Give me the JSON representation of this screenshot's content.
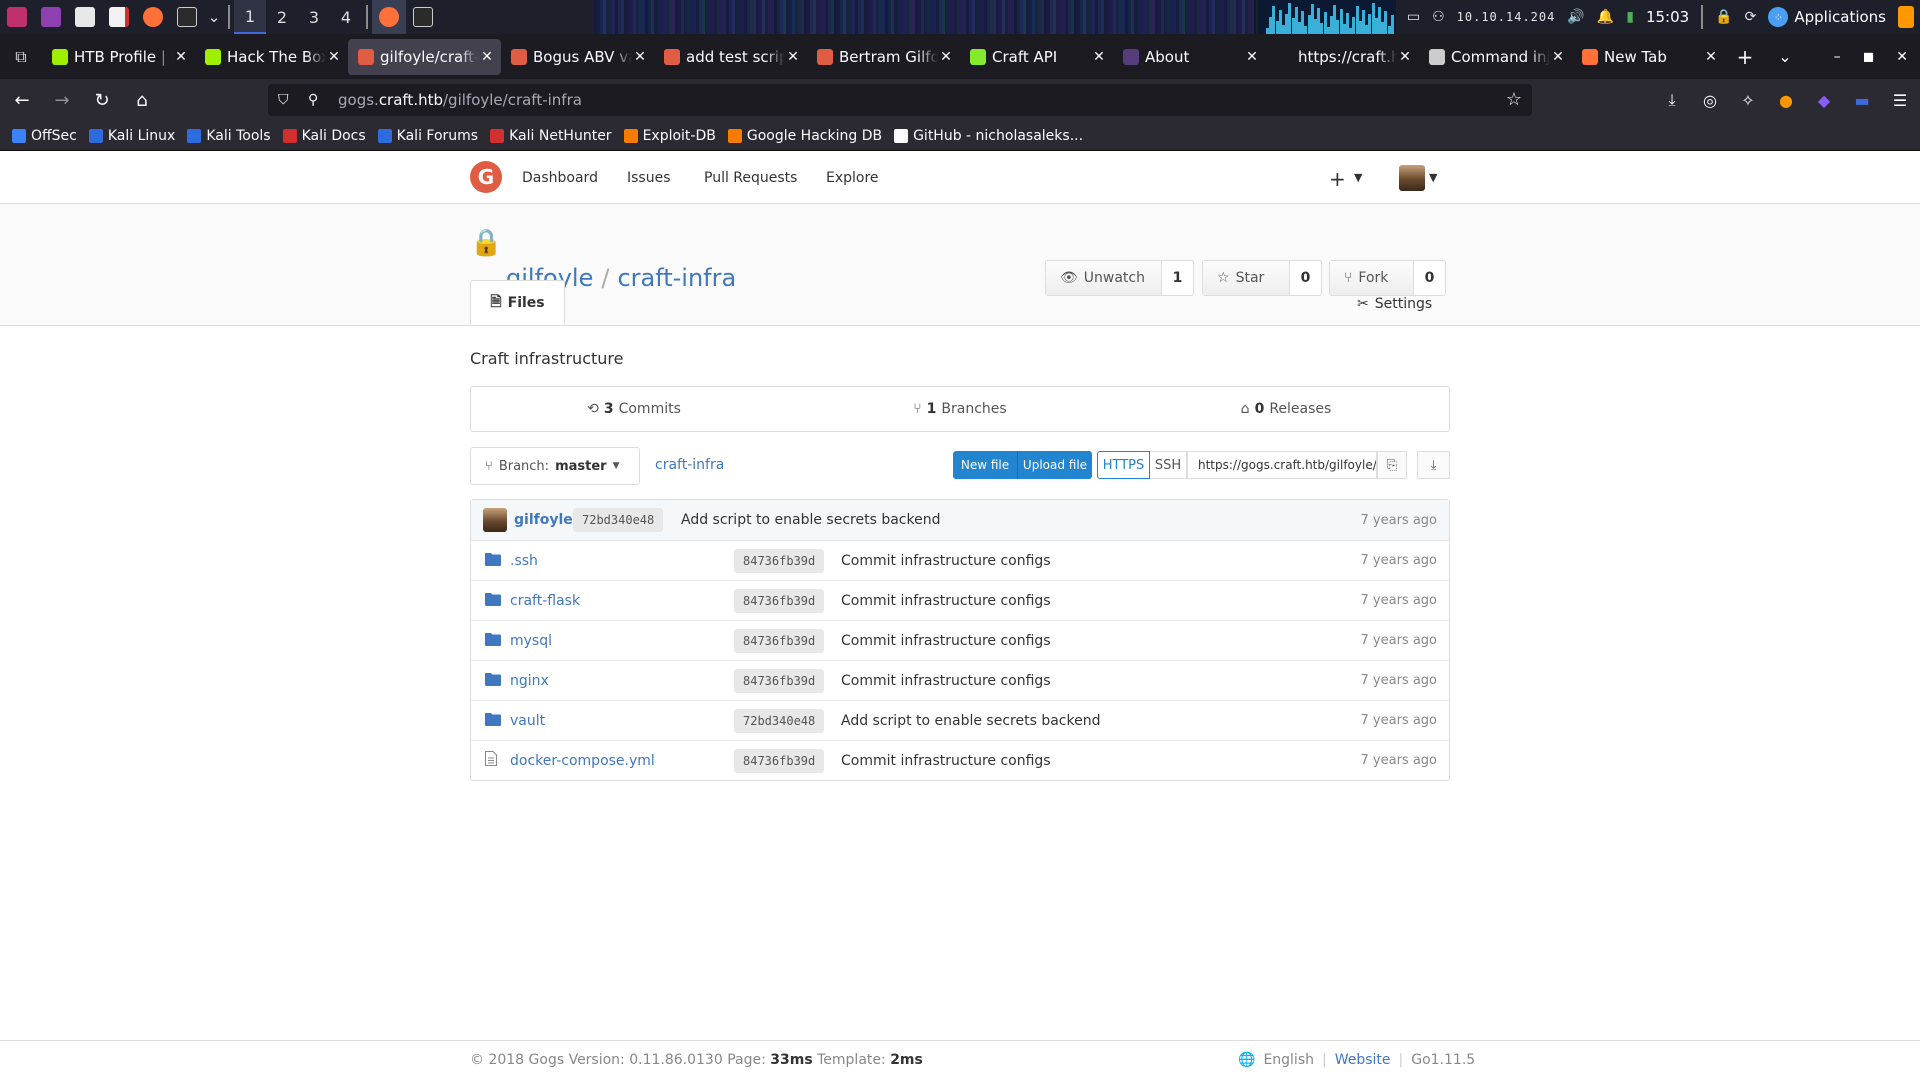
{
  "panel": {
    "workspaces": [
      "1",
      "2",
      "3",
      "4"
    ],
    "ip": "10.10.14.204",
    "clock": "15:03",
    "applications_label": "Applications"
  },
  "tabs": [
    {
      "label": "HTB Profile | H",
      "fav_color": "#9fef00"
    },
    {
      "label": "Hack The Box",
      "fav_color": "#9fef00"
    },
    {
      "label": "gilfoyle/craft-i",
      "fav_color": "#e05d44"
    },
    {
      "label": "Bogus ABV val",
      "fav_color": "#e05d44"
    },
    {
      "label": "add test script",
      "fav_color": "#e05d44"
    },
    {
      "label": "Bertram Gilfoy",
      "fav_color": "#e05d44"
    },
    {
      "label": "Craft API",
      "fav_color": "#85ea2d"
    },
    {
      "label": "About",
      "fav_color": "#563d7c"
    },
    {
      "label": "https://craft.htb/",
      "fav_color": ""
    },
    {
      "label": "Command inje",
      "fav_color": "#cccccc"
    },
    {
      "label": "New Tab",
      "fav_color": "#ff7139"
    }
  ],
  "url": {
    "prefix": "gogs.",
    "host": "craft.htb",
    "path": "/gilfoyle/craft-infra"
  },
  "bookmarks": [
    {
      "label": "OffSec",
      "color": "#3b82f6"
    },
    {
      "label": "Kali Linux",
      "color": "#2d6cdf"
    },
    {
      "label": "Kali Tools",
      "color": "#2d6cdf"
    },
    {
      "label": "Kali Docs",
      "color": "#d32f2f"
    },
    {
      "label": "Kali Forums",
      "color": "#2d6cdf"
    },
    {
      "label": "Kali NetHunter",
      "color": "#d32f2f"
    },
    {
      "label": "Exploit-DB",
      "color": "#f57c00"
    },
    {
      "label": "Google Hacking DB",
      "color": "#f57c00"
    },
    {
      "label": "GitHub - nicholasaleks...",
      "color": "#fbfbfe"
    }
  ],
  "gogs_nav": {
    "dashboard": "Dashboard",
    "issues": "Issues",
    "pull_requests": "Pull Requests",
    "explore": "Explore",
    "plus": "+"
  },
  "repo": {
    "owner": "gilfoyle",
    "slash": "/",
    "name": "craft-infra",
    "unwatch_label": "Unwatch",
    "watch_count": "1",
    "star_label": "Star",
    "star_count": "0",
    "fork_label": "Fork",
    "fork_count": "0",
    "files_tab": "Files",
    "settings_label": "Settings",
    "description": "Craft infrastructure",
    "commits_count": "3",
    "commits_label": "Commits",
    "branches_count": "1",
    "branches_label": "Branches",
    "releases_count": "0",
    "releases_label": "Releases",
    "branch_prefix": "Branch:",
    "branch_name": "master",
    "breadcrumb": "craft-infra",
    "new_file": "New file",
    "upload_file": "Upload file",
    "https_label": "HTTPS",
    "ssh_label": "SSH",
    "clone_url": "https://gogs.craft.htb/gilfoyle/craft-infra.git"
  },
  "latest_commit": {
    "user": "gilfoyle",
    "sha": "72bd340e48",
    "message": "Add script to enable secrets backend",
    "age": "7 years ago"
  },
  "files": [
    {
      "name": ".ssh",
      "type": "dir",
      "sha": "84736fb39d",
      "message": "Commit infrastructure configs",
      "age": "7 years ago"
    },
    {
      "name": "craft-flask",
      "type": "dir",
      "sha": "84736fb39d",
      "message": "Commit infrastructure configs",
      "age": "7 years ago"
    },
    {
      "name": "mysql",
      "type": "dir",
      "sha": "84736fb39d",
      "message": "Commit infrastructure configs",
      "age": "7 years ago"
    },
    {
      "name": "nginx",
      "type": "dir",
      "sha": "84736fb39d",
      "message": "Commit infrastructure configs",
      "age": "7 years ago"
    },
    {
      "name": "vault",
      "type": "dir",
      "sha": "72bd340e48",
      "message": "Add script to enable secrets backend",
      "age": "7 years ago"
    },
    {
      "name": "docker-compose.yml",
      "type": "file",
      "sha": "84736fb39d",
      "message": "Commit infrastructure configs",
      "age": "7 years ago"
    }
  ],
  "footer": {
    "version_text": "© 2018 Gogs Version: 0.11.86.0130 Page:",
    "page_time": "33ms",
    "template_label": "Template:",
    "template_time": "2ms",
    "language": "English",
    "website": "Website",
    "go_version": "Go1.11.5"
  }
}
